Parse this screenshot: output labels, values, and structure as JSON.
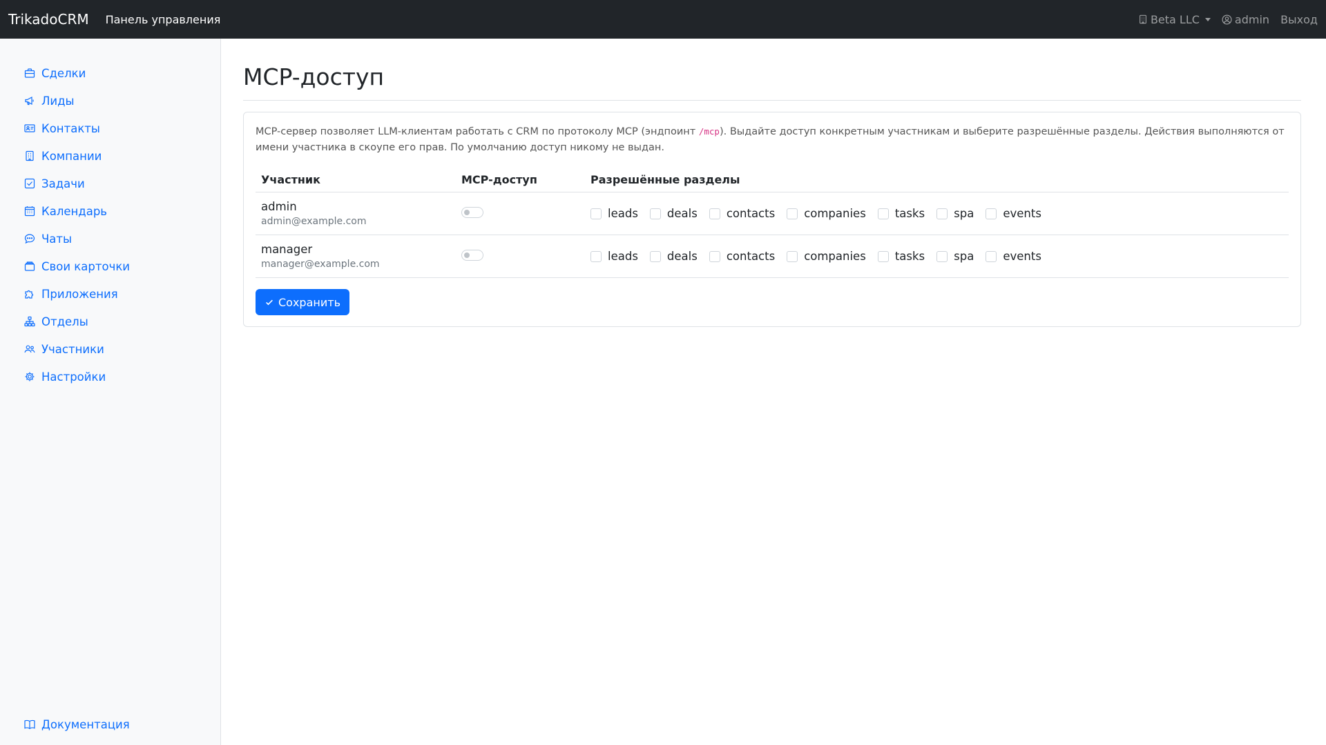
{
  "navbar": {
    "brand": "TrikadoCRM",
    "main_link": "Панель управления",
    "company": "Beta LLC",
    "company_icon": "building-icon",
    "user": "admin",
    "user_icon": "person-circle-icon",
    "logout": "Выход"
  },
  "sidebar": {
    "items": [
      {
        "label": "Сделки",
        "icon": "briefcase-icon"
      },
      {
        "label": "Лиды",
        "icon": "megaphone-icon"
      },
      {
        "label": "Контакты",
        "icon": "person-vcard-icon"
      },
      {
        "label": "Компании",
        "icon": "building-icon"
      },
      {
        "label": "Задачи",
        "icon": "check-square-icon"
      },
      {
        "label": "Календарь",
        "icon": "calendar-icon"
      },
      {
        "label": "Чаты",
        "icon": "chat-icon"
      },
      {
        "label": "Свои карточки",
        "icon": "folder-icon"
      },
      {
        "label": "Приложения",
        "icon": "puzzle-icon"
      },
      {
        "label": "Отделы",
        "icon": "diagram-icon"
      },
      {
        "label": "Участники",
        "icon": "people-icon"
      },
      {
        "label": "Настройки",
        "icon": "gear-icon"
      }
    ],
    "docs": {
      "label": "Документация",
      "icon": "book-icon"
    }
  },
  "page": {
    "title": "MCP-доступ",
    "description_before": "MCP-сервер позволяет LLM-клиентам работать с CRM по протоколу MCP (эндпоинт ",
    "description_code": "/mcp",
    "description_after": "). Выдайте доступ конкретным участникам и выберите разрешённые разделы. Действия выполняются от имени участника в скоупе его прав. По умолчанию доступ никому не выдан.",
    "table": {
      "headers": {
        "user": "Участник",
        "mcp": "MCP-доступ",
        "sections": "Разрешённые разделы"
      },
      "rows": [
        {
          "name": "admin",
          "email": "admin@example.com",
          "mcp_enabled": false,
          "sections": [
            "leads",
            "deals",
            "contacts",
            "companies",
            "tasks",
            "spa",
            "events"
          ]
        },
        {
          "name": "manager",
          "email": "manager@example.com",
          "mcp_enabled": false,
          "sections": [
            "leads",
            "deals",
            "contacts",
            "companies",
            "tasks",
            "spa",
            "events"
          ]
        }
      ]
    },
    "save_label": "Сохранить",
    "save_icon": "check-icon"
  },
  "colors": {
    "navbar_bg": "#212529",
    "accent": "#0d6efd",
    "sidebar_bg": "#f8f9fa"
  }
}
